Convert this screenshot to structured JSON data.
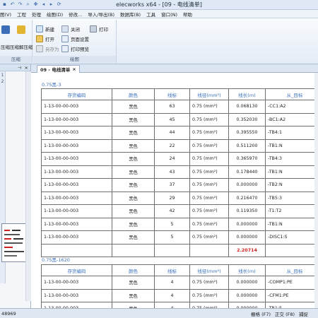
{
  "window": {
    "title": "elecworks x64 - [09 - 电线清单]"
  },
  "menu": [
    "图(V)",
    "工程",
    "处理",
    "绘图(D)",
    "修改...",
    "导入/导出(B)",
    "数据库(B)",
    "工具",
    "窗口(N)",
    "帮助"
  ],
  "ribbon": {
    "left_group": {
      "btn1": "压缩",
      "btn2": "压缩解压缩",
      "label": "压缩"
    },
    "draw_group": {
      "new": "新建",
      "close": "关闭",
      "print": "打印",
      "open": "打开",
      "page_setup": "页面设置",
      "save_as": "另存为",
      "print_preview": "打印预览",
      "label": "绘图"
    }
  },
  "left_panel": {
    "pin": "⊣",
    "close": "×",
    "side_labels": [
      "1",
      "2"
    ]
  },
  "tab": {
    "label": "09 - 电线清单",
    "close": "×"
  },
  "sections": [
    {
      "title": "0.75黑-3",
      "headers": [
        "存货编码",
        "颜色",
        "线标",
        "线径(mm²)",
        "线长(m)",
        "从_目标"
      ],
      "rows": [
        [
          "1-13-00-00-003",
          "黑色",
          "63",
          "0.75 (mm²)",
          "0.068130",
          "-CC1:A2"
        ],
        [
          "1-13-00-00-003",
          "黑色",
          "45",
          "0.75 (mm²)",
          "0.352030",
          "-BC1:A2"
        ],
        [
          "1-13-00-00-003",
          "黑色",
          "44",
          "0.75 (mm²)",
          "0.395550",
          "-TB4:1"
        ],
        [
          "1-13-00-00-003",
          "黑色",
          "22",
          "0.75 (mm²)",
          "0.511200",
          "-TB1:N"
        ],
        [
          "1-13-00-00-003",
          "黑色",
          "24",
          "0.75 (mm²)",
          "0.365970",
          "-TB4:3"
        ],
        [
          "1-13-00-00-003",
          "黑色",
          "43",
          "0.75 (mm²)",
          "0.178440",
          "-TB1:N"
        ],
        [
          "1-13-00-00-003",
          "黑色",
          "37",
          "0.75 (mm²)",
          "0.000000",
          "-TB2:N"
        ],
        [
          "1-13-00-00-003",
          "黑色",
          "29",
          "0.75 (mm²)",
          "0.216470",
          "-TB5:3"
        ],
        [
          "1-13-00-00-003",
          "黑色",
          "42",
          "0.75 (mm²)",
          "0.119350",
          "-T1:T2"
        ],
        [
          "1-13-00-00-003",
          "黑色",
          "5",
          "0.75 (mm²)",
          "0.000000",
          "-TB1:N"
        ],
        [
          "1-13-00-00-003",
          "黑色",
          "5",
          "0.75 (mm²)",
          "0.000000",
          "-DISC1:S"
        ]
      ],
      "total": "2.20714"
    },
    {
      "title": "0.75黑-1620",
      "headers": [
        "存货编码",
        "颜色",
        "线标",
        "线径(mm²)",
        "线长(m)",
        "从_目标"
      ],
      "rows": [
        [
          "1-13-00-00-003",
          "黑色",
          "4",
          "0.75 (mm²)",
          "0.000000",
          "-COMP1:PE"
        ],
        [
          "1-13-00-00-003",
          "黑色",
          "4",
          "0.75 (mm²)",
          "0.000000",
          "-CFM1:PE"
        ],
        [
          "1-13-00-00-003",
          "黑色",
          "4",
          "0.75 (mm²)",
          "0.000000",
          "-TB1:5"
        ]
      ]
    }
  ],
  "status": {
    "coord": "48969",
    "items": [
      "栅格 (F7)",
      "正交 (F8)",
      "捕捉"
    ]
  },
  "colors": {
    "accent": "#3a6fbd",
    "total": "#d32020"
  }
}
